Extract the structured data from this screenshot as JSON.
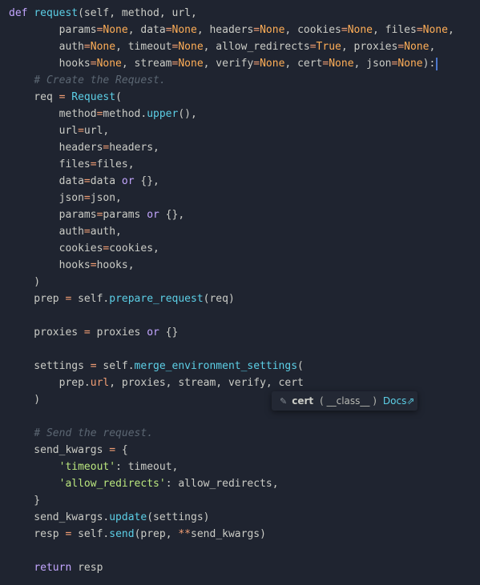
{
  "colors": {
    "background": "#1f2430",
    "text": "#cbccc6",
    "keyword": "#c3a6ff",
    "function": "#5ccfe6",
    "none_constant": "#ffae57",
    "operator": "#f29e74",
    "comment": "#5c6773",
    "string": "#bae67e",
    "cursor": "#4d78cc"
  },
  "code_lines": [
    "def request(self, method, url,",
    "        params=None, data=None, headers=None, cookies=None, files=None,",
    "        auth=None, timeout=None, allow_redirects=True, proxies=None,",
    "        hooks=None, stream=None, verify=None, cert=None, json=None):",
    "    # Create the Request.",
    "    req = Request(",
    "        method=method.upper(),",
    "        url=url,",
    "        headers=headers,",
    "        files=files,",
    "        data=data or {},",
    "        json=json,",
    "        params=params or {},",
    "        auth=auth,",
    "        cookies=cookies,",
    "        hooks=hooks,",
    "    )",
    "    prep = self.prepare_request(req)",
    "",
    "    proxies = proxies or {}",
    "",
    "    settings = self.merge_environment_settings(",
    "        prep.url, proxies, stream, verify, cert",
    "    )",
    "",
    "    # Send the request.",
    "    send_kwargs = {",
    "        'timeout': timeout,",
    "        'allow_redirects': allow_redirects,",
    "    }",
    "    send_kwargs.update(settings)",
    "    resp = self.send(prep, **send_kwargs)",
    "",
    "    return resp"
  ],
  "tooltip": {
    "icon": "variable-icon",
    "name": "cert",
    "type": "( __class__ )",
    "docs_label": "Docs",
    "docs_arrow": "⇗"
  }
}
